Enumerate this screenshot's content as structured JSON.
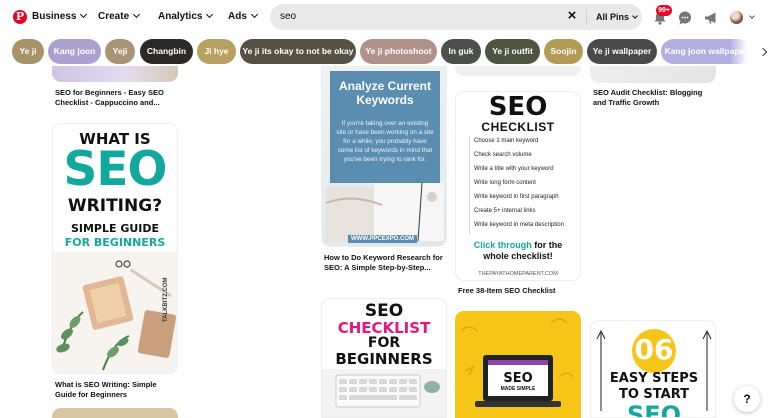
{
  "header": {
    "logo_letter": "P",
    "nav": [
      {
        "label": "Business"
      },
      {
        "label": "Create"
      },
      {
        "label": "Analytics"
      },
      {
        "label": "Ads"
      }
    ],
    "search": {
      "value": "seo"
    },
    "filter_label": "All Pins",
    "notification_count": "99+"
  },
  "chips": [
    {
      "label": "Ye ji",
      "color": "#a89268"
    },
    {
      "label": "Kang joon",
      "color": "#aca0d0"
    },
    {
      "label": "Yeji",
      "color": "#a89375"
    },
    {
      "label": "Changbin",
      "color": "#2c2a26"
    },
    {
      "label": "Ji hye",
      "color": "#b8a060"
    },
    {
      "label": "Ye ji its okay to not be okay",
      "color": "#565243"
    },
    {
      "label": "Ye ji photoshoot",
      "color": "#b0928a"
    },
    {
      "label": "In guk",
      "color": "#4c4f4b"
    },
    {
      "label": "Ye ji outfit",
      "color": "#4d5540"
    },
    {
      "label": "Soojin",
      "color": "#b39a55"
    },
    {
      "label": "Ye ji wallpaper",
      "color": "#4a4a4a"
    },
    {
      "label": "Kang joon wallpaper",
      "color": "#b3aee0"
    }
  ],
  "pins": {
    "col1_top_caption": "SEO for Beginners - Easy SEO Checklist - Cappuccino and...",
    "seo_writing": {
      "line1": "WHAT IS",
      "line2": "SEO",
      "line3": "WRITING?",
      "line4": "SIMPLE GUIDE",
      "line5": "FOR BEGINNERS",
      "watermark": "TALKBITZ.COM",
      "caption": "What is SEO Writing: Simple Guide for Beginners"
    },
    "keywords": {
      "title": "Analyze Current Keywords",
      "body": "If you're taking over an existing site or have been working on a site for a while, you probably have some list of keywords in mind that you've been trying to rank for.",
      "url": "WWW.PPCEXPO.COM",
      "caption": "How to Do Keyword Research for SEO: A Simple Step-by-Step..."
    },
    "checklist38": {
      "title1": "SEO",
      "title2": "CHECKLIST",
      "items": [
        "Choose 1 main keyword",
        "Check search volume",
        "Write a title with your keyword",
        "Write long form content",
        "Write keyword in first paragraph",
        "Create 5+ internal links",
        "Write keyword in meta description"
      ],
      "cta_a": "Click through",
      "cta_b": " for the",
      "cta_c": "whole checklist!",
      "site": "THEPAYATHOMEPARENT.COM",
      "caption": "Free 38-Item SEO Checklist"
    },
    "audit_caption": "SEO Audit Checklist: Blogging and Traffic Growth",
    "seo_beginners": {
      "l1": "SEO",
      "l2": "CHECKLIST",
      "l3": "FOR",
      "l4": "BEGINNERS"
    },
    "seo_simple": {
      "label": "SEO",
      "sub": "MADE SIMPLE"
    },
    "easy_steps": {
      "num": "06",
      "l1": "EASY STEPS",
      "l2": "TO START",
      "l3": "SEO"
    }
  },
  "help_label": "?",
  "colors": {
    "brand": "#e60023",
    "teal": "#13a89e",
    "pink": "#e2187c",
    "yellow": "#f5c518"
  },
  "icons": [
    "pinterest-logo-icon",
    "clear-icon",
    "bell-icon",
    "message-icon",
    "megaphone-icon",
    "avatar-icon"
  ]
}
